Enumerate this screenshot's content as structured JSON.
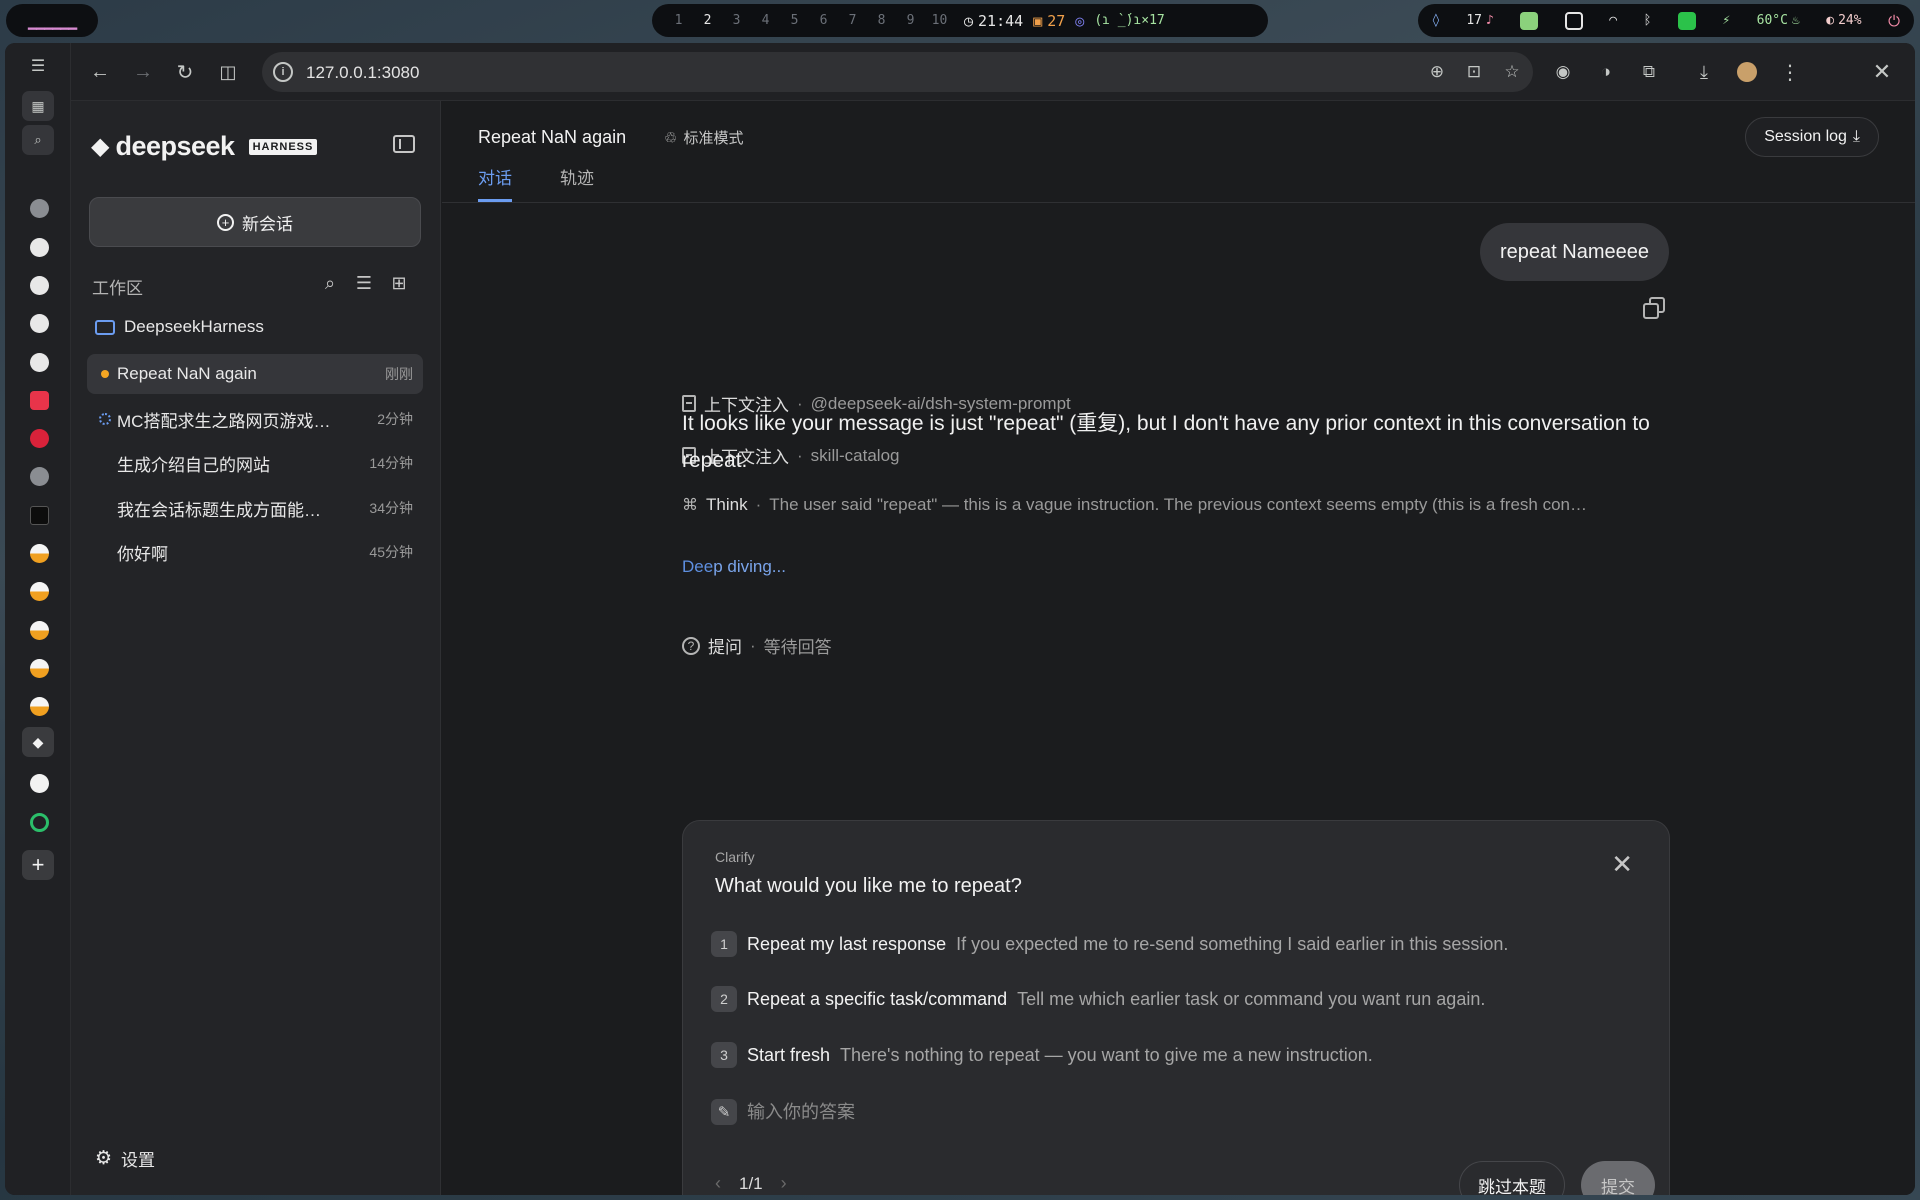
{
  "system_bar": {
    "workspaces": [
      "1",
      "2",
      "3",
      "4",
      "5",
      "6",
      "7",
      "8",
      "9",
      "10"
    ],
    "active_workspace": "2",
    "clock": "21:44",
    "notes_count": "27",
    "kaomoji": "(ɿ ̀_́)ɿ×17",
    "notification_count": "17",
    "temperature": "60°C",
    "battery": "24%"
  },
  "browser": {
    "url": "127.0.0.1:3080"
  },
  "sidebar": {
    "brand": "deepseek",
    "brand_badge": "HARNESS",
    "new_chat_label": "新会话",
    "workspace_title": "工作区",
    "folder_name": "DeepseekHarness",
    "sessions": [
      {
        "title": "Repeat NaN again",
        "time": "刚刚"
      },
      {
        "title": "MC搭配求生之路网页游戏…",
        "time": "2分钟"
      },
      {
        "title": "生成介绍自己的网站",
        "time": "14分钟"
      },
      {
        "title": "我在会话标题生成方面能…",
        "time": "34分钟"
      },
      {
        "title": "你好啊",
        "time": "45分钟"
      }
    ],
    "settings_label": "设置"
  },
  "header": {
    "title": "Repeat NaN again",
    "mode": "标准模式",
    "tabs": [
      "对话",
      "轨迹"
    ],
    "session_log": "Session log"
  },
  "conversation": {
    "user_message": "repeat Nameeee",
    "steps": [
      {
        "label": "上下文注入",
        "meta": "@deepseek-ai/dsh-system-prompt"
      },
      {
        "label": "上下文注入",
        "meta": "skill-catalog"
      },
      {
        "label": "Think",
        "meta": "The user said \"repeat\" — this is a vague instruction. The previous context seems empty (this is a fresh con…"
      }
    ],
    "answer": "It looks like your message is just \"repeat\" (重复), but I don't have any prior context in this conversation to repeat.",
    "question_step": {
      "label": "提问",
      "meta": "等待回答"
    },
    "status_a": "Dee",
    "status_b": "p diving..."
  },
  "clarify": {
    "label": "Clarify",
    "question": "What would you like me to repeat?",
    "options": [
      {
        "num": "1",
        "title": "Repeat my last response",
        "desc": "If you expected me to re-send something I said earlier in this session."
      },
      {
        "num": "2",
        "title": "Repeat a specific task/command",
        "desc": "Tell me which earlier task or command you want run again."
      },
      {
        "num": "3",
        "title": "Start fresh",
        "desc": "There's nothing to repeat — you want to give me a new instruction."
      }
    ],
    "answer_placeholder": "输入你的答案",
    "pager": "1/1",
    "skip_label": "跳过本题",
    "submit_label": "提交"
  }
}
